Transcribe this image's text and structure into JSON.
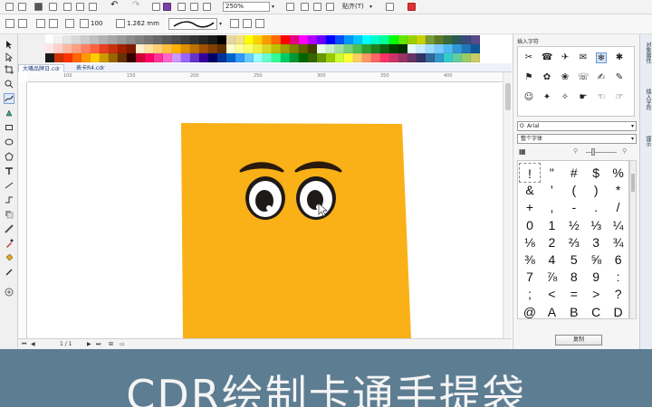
{
  "toolbar": {
    "undo_label": "↶",
    "redo_label": "↷",
    "nudge_value": "100",
    "size_value": "1.262 mm",
    "zoom_value": "250%",
    "snap_label": "贴齐(T)"
  },
  "document_tabs": [
    {
      "label": "大嘴品牌日.cdr"
    },
    {
      "label": "表卡R4.cdr"
    }
  ],
  "ruler_labels": [
    "100",
    "150",
    "200",
    "250",
    "300",
    "350",
    "400"
  ],
  "status": {
    "page": "1 / 1"
  },
  "palette_colors": [
    [
      "#ffffff",
      "#f2f2f2",
      "#e5e5e5",
      "#d9d9d9",
      "#cccccc",
      "#bfbfbf",
      "#b2b2b2",
      "#a6a6a6",
      "#999999",
      "#8c8c8c",
      "#808080",
      "#737373",
      "#666666",
      "#595959",
      "#4d4d4d",
      "#404040",
      "#333333",
      "#262626",
      "#1a1a1a",
      "#000000",
      "#e8d6a0",
      "#f0e08a",
      "#ffff00",
      "#ffd200",
      "#ff9900",
      "#ff6a00",
      "#ff0000",
      "#e6007e",
      "#ff00ff",
      "#b400ff",
      "#6a00ff",
      "#0000ff",
      "#0050ff",
      "#0096ff",
      "#00c8ff",
      "#00ffff",
      "#00ffc8",
      "#00ff96",
      "#00ff00",
      "#64e600",
      "#9bd200",
      "#c8d200",
      "#7a9a3a",
      "#5a7a2a",
      "#3a6a3a",
      "#2a5a5a",
      "#3a4a7a",
      "#5a4a8a"
    ],
    [
      "#ffe6e6",
      "#ffd0c8",
      "#ffb8a0",
      "#ff9f80",
      "#ff8060",
      "#ff6040",
      "#e84020",
      "#c83010",
      "#a02000",
      "#801800",
      "#ffeecc",
      "#ffe0a0",
      "#ffd070",
      "#ffc040",
      "#ffb000",
      "#e09000",
      "#c07000",
      "#a05000",
      "#804000",
      "#603000",
      "#ffffcc",
      "#ffff99",
      "#ffff66",
      "#f0f040",
      "#d8d820",
      "#c0c000",
      "#a0a000",
      "#808000",
      "#606000",
      "#404000",
      "#e6ffe6",
      "#c8f0c8",
      "#a0e0a0",
      "#78d078",
      "#50c050",
      "#30a030",
      "#208020",
      "#106010",
      "#004000",
      "#003000",
      "#e6f8ff",
      "#c8ecff",
      "#a0dcff",
      "#78ccff",
      "#50b8f0",
      "#3098d8",
      "#2078b8",
      "#105898"
    ],
    [
      "#1a1a1a",
      "#cc3300",
      "#ff3300",
      "#ff6600",
      "#ff9900",
      "#ffcc00",
      "#cc9900",
      "#996600",
      "#663300",
      "#330000",
      "#cc0033",
      "#ff0066",
      "#ff3399",
      "#ff66cc",
      "#cc99ff",
      "#9966ff",
      "#6633cc",
      "#330099",
      "#000066",
      "#003399",
      "#0066cc",
      "#3399ff",
      "#66ccff",
      "#99ffff",
      "#66ffcc",
      "#33ff99",
      "#00cc66",
      "#009933",
      "#006600",
      "#336600",
      "#669900",
      "#99cc00",
      "#ccff33",
      "#ffff33",
      "#ffcc66",
      "#ff9966",
      "#ff6666",
      "#ff3366",
      "#cc3366",
      "#993366",
      "#663366",
      "#333366",
      "#336699",
      "#3399cc",
      "#33cccc",
      "#66cc99",
      "#99cc66",
      "#cccc66"
    ]
  ],
  "docker": {
    "title": "插入字符",
    "preview_symbols": [
      "✂",
      "☎",
      "✈",
      "✉",
      "❄",
      "✱",
      "⚑",
      "✿",
      "❀",
      "☏",
      "✍",
      "✎",
      "☺",
      "✦",
      "✧",
      "☛",
      "☜",
      "☞"
    ],
    "font_value": "Arial",
    "subset_value": "整个字体",
    "copy_button_label": "复制"
  },
  "char_grid": [
    "!",
    "\"",
    "#",
    "$",
    "%",
    "&",
    "'",
    "(",
    ")",
    "*",
    "+",
    ",",
    "-",
    ".",
    "/",
    "0",
    "1",
    "½",
    "⅓",
    "¼",
    "⅛",
    "2",
    "⅔",
    "3",
    "¾",
    "⅜",
    "4",
    "5",
    "⅝",
    "6",
    "7",
    "⅞",
    "8",
    "9",
    ":",
    ";",
    "<",
    "=",
    ">",
    "?",
    "@",
    "A",
    "B",
    "C",
    "D"
  ],
  "side_tabs": [
    "对象属性",
    "插入字符",
    "提示"
  ],
  "colors": {
    "bag_orange": "#f9b117",
    "caption_band": "#5d7d92",
    "caption_text": "#f4f4f4"
  },
  "caption": {
    "text": "CDR绘制卡通手提袋"
  }
}
